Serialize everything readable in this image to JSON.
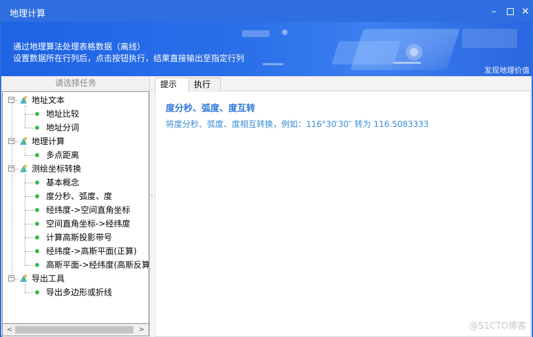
{
  "window": {
    "title": "地理计算",
    "buttons": {
      "minimize": "–",
      "maximize": "",
      "close": "✕"
    }
  },
  "banner": {
    "line1": "通过地理算法处理表格数据（离线）",
    "line2": "设置数据所在行列后，点击按钮执行，结果直接输出至指定行列",
    "link": "发现地理价值"
  },
  "task_panel": {
    "header": "请选择任务",
    "groups": [
      {
        "label": "地址文本",
        "items": [
          "地址比较",
          "地址分词"
        ]
      },
      {
        "label": "地理计算",
        "items": [
          "多点距离"
        ]
      },
      {
        "label": "测绘坐标转换",
        "items": [
          "基本概念",
          "度分秒、弧度、度",
          "经纬度->空间直角坐标",
          "空间直角坐标->经纬度",
          "计算高斯投影带号",
          "经纬度->高斯平面(正算)",
          "高斯平面->经纬度(高斯反算"
        ]
      },
      {
        "label": "导出工具",
        "items": [
          "导出多边形或折线"
        ]
      }
    ],
    "scroll_left": "<",
    "scroll_right": ">"
  },
  "tabs": {
    "hint": "提示",
    "execute": "执行"
  },
  "content": {
    "title": "度分秒、弧度、度互转",
    "description": "将度分秒、弧度、度相互转换，例如：116°30′30″ 转为 116.5083333"
  },
  "watermark": "@51CTO博客",
  "colors": {
    "accent": "#2f6ee0",
    "link_text": "#2e76d8",
    "leaf_dot": "#3cb94a"
  }
}
